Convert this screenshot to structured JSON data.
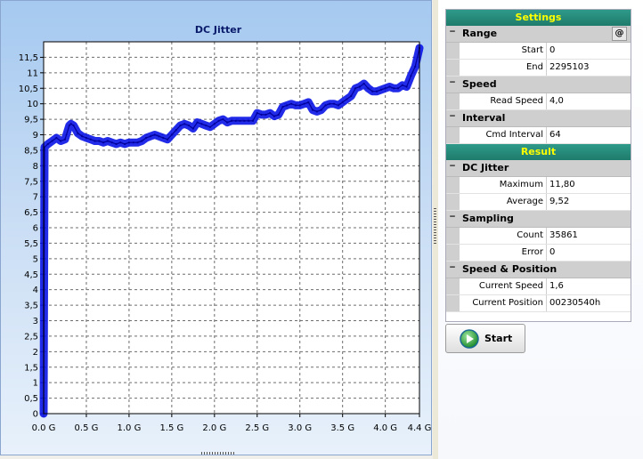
{
  "chart": {
    "title": "DC Jitter"
  },
  "chart_data": {
    "type": "line",
    "title": "DC Jitter",
    "xlabel": "",
    "ylabel": "",
    "xlim": [
      0,
      4.4
    ],
    "ylim": [
      0,
      12
    ],
    "x_ticks": [
      "0.0 G",
      "0.5 G",
      "1.0 G",
      "1.5 G",
      "2.0 G",
      "2.5 G",
      "3.0 G",
      "3.5 G",
      "4.0 G",
      "4.4 G"
    ],
    "y_ticks": [
      "0",
      "0,5",
      "1",
      "1,5",
      "2",
      "2,5",
      "3",
      "3,5",
      "4",
      "4,5",
      "5",
      "5,5",
      "6",
      "6,5",
      "7",
      "7,5",
      "8",
      "8,5",
      "9",
      "9,5",
      "10",
      "10,5",
      "11",
      "11,5"
    ],
    "grid": true,
    "series": [
      {
        "color": "#0a14e6",
        "x": [
          0.0,
          0.01,
          0.05,
          0.1,
          0.15,
          0.2,
          0.25,
          0.3,
          0.32,
          0.35,
          0.4,
          0.45,
          0.5,
          0.55,
          0.6,
          0.65,
          0.7,
          0.75,
          0.8,
          0.85,
          0.9,
          0.95,
          1.0,
          1.05,
          1.1,
          1.15,
          1.2,
          1.25,
          1.3,
          1.35,
          1.4,
          1.45,
          1.5,
          1.55,
          1.6,
          1.65,
          1.7,
          1.75,
          1.8,
          1.85,
          1.9,
          1.95,
          2.0,
          2.05,
          2.1,
          2.15,
          2.2,
          2.25,
          2.3,
          2.35,
          2.4,
          2.45,
          2.5,
          2.55,
          2.6,
          2.65,
          2.7,
          2.75,
          2.8,
          2.85,
          2.9,
          2.95,
          3.0,
          3.05,
          3.1,
          3.15,
          3.2,
          3.25,
          3.3,
          3.35,
          3.4,
          3.45,
          3.5,
          3.55,
          3.6,
          3.65,
          3.7,
          3.75,
          3.8,
          3.85,
          3.9,
          3.95,
          4.0,
          4.05,
          4.1,
          4.15,
          4.2,
          4.25,
          4.3,
          4.35,
          4.4
        ],
        "y": [
          0,
          8.6,
          8.7,
          8.8,
          8.9,
          8.8,
          8.85,
          9.3,
          9.35,
          9.3,
          9.05,
          8.95,
          8.9,
          8.85,
          8.8,
          8.8,
          8.75,
          8.8,
          8.75,
          8.7,
          8.75,
          8.7,
          8.75,
          8.75,
          8.75,
          8.8,
          8.9,
          8.95,
          9.0,
          8.95,
          8.9,
          8.85,
          9.0,
          9.15,
          9.3,
          9.35,
          9.3,
          9.2,
          9.4,
          9.35,
          9.3,
          9.25,
          9.35,
          9.45,
          9.5,
          9.4,
          9.45,
          9.45,
          9.45,
          9.45,
          9.45,
          9.45,
          9.7,
          9.65,
          9.65,
          9.7,
          9.6,
          9.65,
          9.9,
          9.95,
          10.0,
          9.95,
          9.95,
          10.0,
          10.05,
          9.8,
          9.75,
          9.8,
          9.95,
          10.0,
          10.0,
          9.95,
          10.05,
          10.15,
          10.25,
          10.5,
          10.55,
          10.65,
          10.5,
          10.4,
          10.4,
          10.45,
          10.5,
          10.55,
          10.5,
          10.5,
          10.6,
          10.55,
          10.9,
          11.2,
          11.8
        ]
      }
    ]
  },
  "settings": {
    "header": "Settings",
    "range": {
      "title": "Range",
      "at": "@",
      "start_label": "Start",
      "start_value": "0",
      "end_label": "End",
      "end_value": "2295103"
    },
    "speed": {
      "title": "Speed",
      "read_speed_label": "Read Speed",
      "read_speed_value": "4,0"
    },
    "interval": {
      "title": "Interval",
      "cmd_label": "Cmd Interval",
      "cmd_value": "64"
    }
  },
  "result": {
    "header": "Result",
    "dc_jitter": {
      "title": "DC Jitter",
      "max_label": "Maximum",
      "max_value": "11,80",
      "avg_label": "Average",
      "avg_value": "9,52"
    },
    "sampling": {
      "title": "Sampling",
      "count_label": "Count",
      "count_value": "35861",
      "error_label": "Error",
      "error_value": "0"
    },
    "speed_position": {
      "title": "Speed & Position",
      "speed_label": "Current Speed",
      "speed_value": "1,6",
      "pos_label": "Current Position",
      "pos_value": "00230540h"
    }
  },
  "start_button": {
    "label": "Start",
    "icon": "play-icon"
  }
}
